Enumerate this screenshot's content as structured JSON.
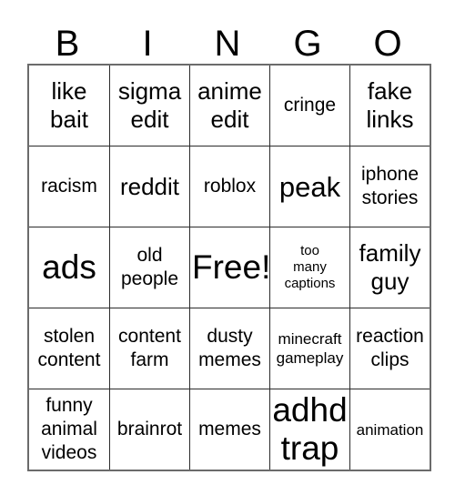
{
  "card": {
    "title": "BINGO",
    "header_letters": [
      "B",
      "I",
      "N",
      "G",
      "O"
    ],
    "grid_border_color": "#6b6b6b",
    "cell_border_color": "#2b2b2b",
    "background_color": "#ffffff",
    "text_color": "#000000",
    "columns": 5,
    "rows": 5,
    "free_space": "Free!",
    "cells": [
      [
        {
          "text": "like\nbait",
          "size": "lg"
        },
        {
          "text": "sigma\nedit",
          "size": "lg"
        },
        {
          "text": "anime\nedit",
          "size": "lg"
        },
        {
          "text": "cringe",
          "size": "md"
        },
        {
          "text": "fake\nlinks",
          "size": "lg"
        }
      ],
      [
        {
          "text": "racism",
          "size": "md"
        },
        {
          "text": "reddit",
          "size": "lg"
        },
        {
          "text": "roblox",
          "size": "md"
        },
        {
          "text": "peak",
          "size": "xl"
        },
        {
          "text": "iphone\nstories",
          "size": "md"
        }
      ],
      [
        {
          "text": "ads",
          "size": "xxl"
        },
        {
          "text": "old\npeople",
          "size": "md"
        },
        {
          "text": "Free!",
          "size": "xxl"
        },
        {
          "text": "too\nmany\ncaptions",
          "size": "xs"
        },
        {
          "text": "family\nguy",
          "size": "lg"
        }
      ],
      [
        {
          "text": "stolen\ncontent",
          "size": "md"
        },
        {
          "text": "content\nfarm",
          "size": "md"
        },
        {
          "text": "dusty\nmemes",
          "size": "md"
        },
        {
          "text": "minecraft\ngameplay",
          "size": "sm"
        },
        {
          "text": "reaction\nclips",
          "size": "md"
        }
      ],
      [
        {
          "text": "funny\nanimal\nvideos",
          "size": "md"
        },
        {
          "text": "brainrot",
          "size": "md"
        },
        {
          "text": "memes",
          "size": "md"
        },
        {
          "text": "adhd\ntrap",
          "size": "xxl"
        },
        {
          "text": "animation",
          "size": "sm"
        }
      ]
    ]
  }
}
